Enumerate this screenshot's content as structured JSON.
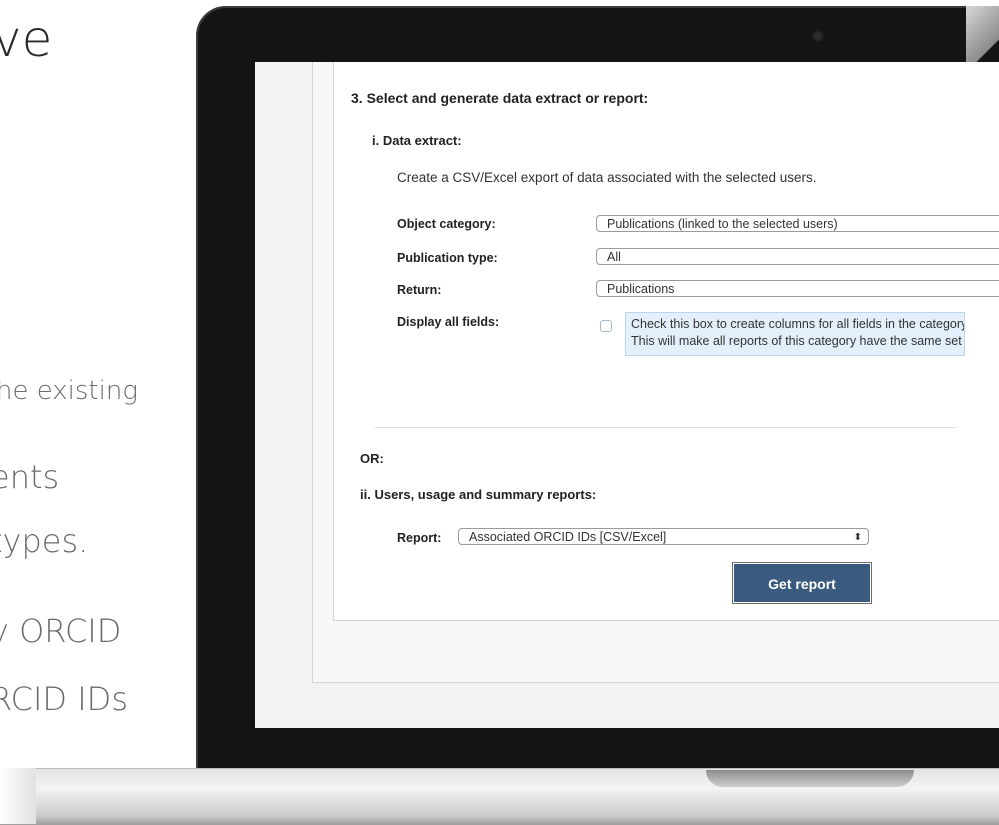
{
  "slide": {
    "title_fragment": "ve",
    "line1": "he existing",
    "line2": "ents",
    "line3": "types.",
    "line4": "y ORCID",
    "line5": "RCID IDs"
  },
  "section": {
    "heading": "3. Select and generate data extract or report:",
    "data_extract": {
      "heading": "i. Data extract:",
      "description": "Create a CSV/Excel export of data associated with the selected users.",
      "fields": {
        "object_category": {
          "label": "Object category:",
          "value": "Publications (linked to the selected users)"
        },
        "publication_type": {
          "label": "Publication type:",
          "value": "All"
        },
        "return": {
          "label": "Return:",
          "value": "Publications"
        },
        "display_all_fields": {
          "label": "Display all fields:",
          "hint_line1": "Check this box to create columns for all fields in the category,",
          "hint_line2": "This will make all reports of this category have the same set o"
        }
      }
    },
    "or_label": "OR:",
    "reports": {
      "heading": "ii. Users, usage and summary reports:",
      "report_label": "Report:",
      "report_value": "Associated ORCID IDs [CSV/Excel]",
      "button_label": "Get report"
    }
  },
  "icons": {
    "select_arrow": "updown-chevron-icon",
    "camera": "camera-icon"
  }
}
